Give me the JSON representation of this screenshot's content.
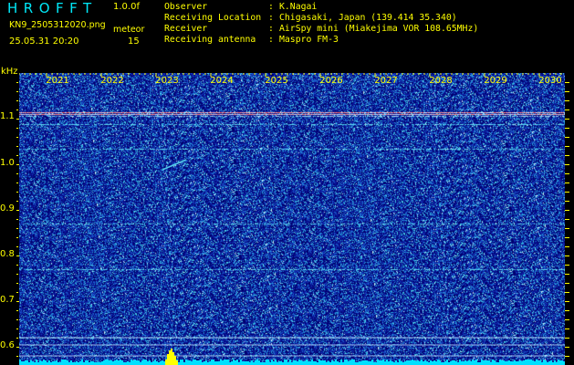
{
  "header": {
    "app_title": "HROFFT",
    "version": "1.0.0f",
    "file_name": "KN9_2505312020.png",
    "datetime": "25.05.31 20:20",
    "meteor_label": "meteor",
    "meteor_count": "15"
  },
  "info": [
    {
      "key": "Observer",
      "sep": ":",
      "value": "K.Nagai"
    },
    {
      "key": "Receiving Location",
      "sep": ":",
      "value": "Chigasaki, Japan (139.414 35.340)"
    },
    {
      "key": "Receiver",
      "sep": ":",
      "value": "AirSpy mini (Miakejima VOR 108.65MHz)"
    },
    {
      "key": "Receiving antenna",
      "sep": ":",
      "value": "Maspro FM-3"
    }
  ],
  "axis": {
    "unit": "kHz",
    "x_ticks": [
      "2021",
      "2022",
      "2023",
      "2024",
      "2025",
      "2026",
      "2027",
      "2028",
      "2029",
      "2030"
    ],
    "y_ticks": [
      "1.1",
      "1.0",
      "0.9",
      "0.8",
      "0.7",
      "0.6"
    ]
  },
  "colors": {
    "label": "#ffff00",
    "title": "#00e8f8",
    "background": "#000080"
  }
}
